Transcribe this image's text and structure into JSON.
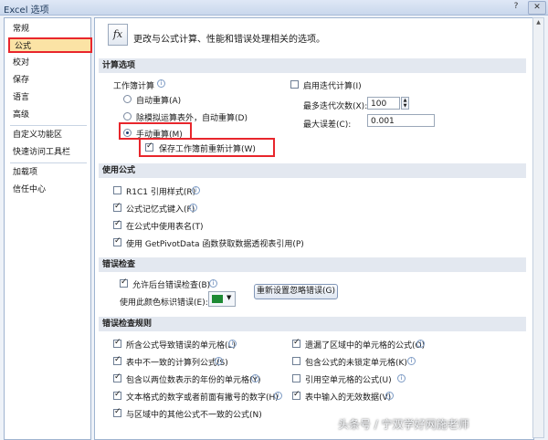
{
  "window": {
    "title": "Excel 选项",
    "help": "?",
    "close": "✕"
  },
  "sidebar": {
    "items": [
      "常规",
      "公式",
      "校对",
      "保存",
      "语言",
      "高级",
      "自定义功能区",
      "快速访问工具栏",
      "加载项",
      "信任中心"
    ],
    "selected_index": 1
  },
  "header": {
    "icon": "fx",
    "text": "更改与公式计算、性能和错误处理相关的选项。"
  },
  "calc": {
    "section_title": "计算选项",
    "workbook_calc_label": "工作簿计算",
    "radio_auto": "自动重算(A)",
    "radio_auto_except": "除模拟运算表外，自动重算(D)",
    "radio_manual": "手动重算(M)",
    "recalc_before_save": "保存工作簿前重新计算(W)",
    "iterative_label": "启用迭代计算(I)",
    "max_iter_label": "最多迭代次数(X):",
    "max_iter_value": "100",
    "max_change_label": "最大误差(C):",
    "max_change_value": "0.001",
    "manual_selected": true,
    "recalc_checked": true,
    "iterative_checked": false
  },
  "formulas": {
    "section_title": "使用公式",
    "r1c1": "R1C1 引用样式(R)",
    "autocomplete": "公式记忆式键入(F)",
    "table_names": "在公式中使用表名(T)",
    "getpivot": "使用 GetPivotData 函数获取数据透视表引用(P)",
    "checked": [
      false,
      true,
      true,
      true
    ]
  },
  "errors": {
    "section_title": "错误检查",
    "bg_check": "允许后台错误检查(B)",
    "color_label": "使用此颜色标识错误(E):",
    "reset_button": "重新设置忽略错误(G)",
    "indicator_color": "#1e8a34"
  },
  "rules": {
    "section_title": "错误检查规则",
    "left": [
      "所含公式导致错误的单元格(L)",
      "表中不一致的计算列公式(S)",
      "包含以两位数表示的年份的单元格(Y)",
      "文本格式的数字或者前面有撇号的数字(H)",
      "与区域中的其他公式不一致的公式(N)"
    ],
    "right": [
      "遗漏了区域中的单元格的公式(O)",
      "包含公式的未锁定单元格(K)",
      "引用空单元格的公式(U)",
      "表中输入的无效数据(V)"
    ],
    "left_checked": [
      true,
      true,
      true,
      true,
      true
    ],
    "right_checked": [
      true,
      false,
      false,
      true
    ]
  },
  "watermark": "头条号 / 宁双学好网施老师",
  "accent": "#e8262c"
}
